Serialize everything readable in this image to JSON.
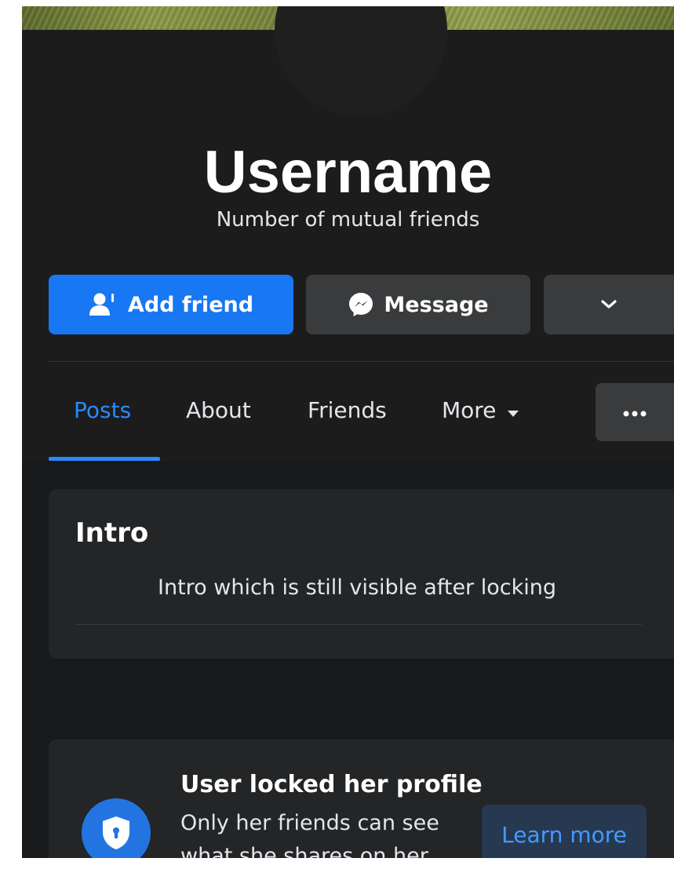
{
  "profile": {
    "username": "Username",
    "mutual_friends": "Number of mutual friends"
  },
  "actions": {
    "add_friend_label": "Add friend",
    "message_label": "Message"
  },
  "tabs": [
    {
      "label": "Posts",
      "active": true
    },
    {
      "label": "About",
      "active": false
    },
    {
      "label": "Friends",
      "active": false
    },
    {
      "label": "More",
      "active": false
    }
  ],
  "intro": {
    "title": "Intro",
    "text": "Intro which is still visible after locking"
  },
  "locked": {
    "title": "User locked her profile",
    "description": "Only her friends can see what she shares on her profile.",
    "learn_more_label": "Learn more"
  },
  "colors": {
    "primary_blue": "#1877f2",
    "background": "#1c1c1d",
    "card": "#242526",
    "secondary_button": "#3a3b3c"
  },
  "icons": {
    "add_friend": "person-add-icon",
    "message": "messenger-icon",
    "dropdown": "chevron-down-icon",
    "more_tab": "caret-down-icon",
    "options": "ellipsis-icon",
    "lock": "shield-lock-icon"
  }
}
